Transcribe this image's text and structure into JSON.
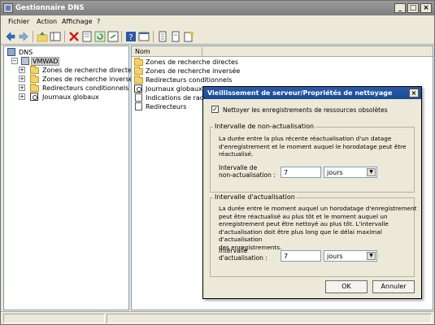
{
  "window": {
    "title": "Gestionnaire DNS"
  },
  "menu": [
    "Fichier",
    "Action",
    "Affichage",
    "?"
  ],
  "toolbar_icons": [
    "back-icon",
    "forward-icon",
    "up-icon",
    "show-hide-tree-icon",
    "delete-icon",
    "properties-icon",
    "refresh-icon",
    "export-icon",
    "help-icon",
    "console-icon",
    "list-icon",
    "text-icon",
    "new-icon"
  ],
  "tree": {
    "root": "DNS",
    "server": "VMWAD",
    "children": [
      "Zones de recherche directes",
      "Zones de recherche inversée",
      "Redirecteurs conditionnels",
      "Journaux globaux"
    ]
  },
  "list": {
    "column": "Nom",
    "items": [
      "Zones de recherche directes",
      "Zones de recherche inversée",
      "Redirecteurs conditionnels",
      "Journaux globaux",
      "Indications de racine",
      "Redirecteurs"
    ]
  },
  "dialog": {
    "title": "Vieillissement de serveur/Propriétés de nettoyage",
    "scavenge_label": "Nettoyer les enregistrements de ressources obsolètes",
    "scavenge_checked": true,
    "noref": {
      "legend": "Intervalle de non-actualisation",
      "description": [
        "La durée entre la plus récente réactualisation d'un datage",
        "d'enregistrement et le moment auquel le horodatage peut être",
        "réactualisé."
      ],
      "field_label": [
        "Intervalle de",
        "non-actualisation :"
      ],
      "value": "7",
      "unit": "jours"
    },
    "refresh": {
      "legend": "Intervalle d'actualisation",
      "description": [
        "La durée entre le moment auquel un horodatage d'enregistrement",
        "peut être réactualisé au plus tôt et le moment auquel un",
        "enregistrement peut être nettoyé au plus tôt. L'intervalle",
        "d'actualisation doit être plus long que le délai maximal d'actualisation",
        "des enregistrements."
      ],
      "field_label": [
        "Intervalle",
        "d'actualisation :"
      ],
      "value": "7",
      "unit": "jours"
    },
    "ok": "OK",
    "cancel": "Annuler"
  }
}
